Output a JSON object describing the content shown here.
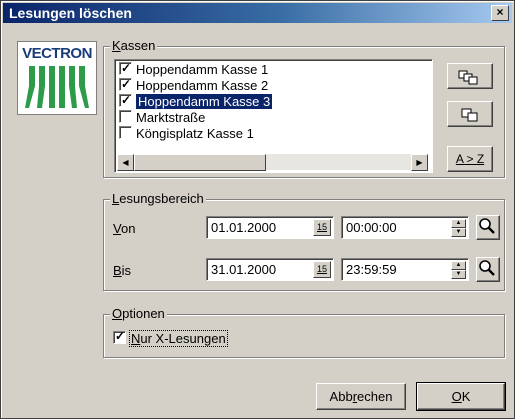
{
  "window": {
    "title": "Lesungen löschen",
    "close_glyph": "×"
  },
  "logo": {
    "text": "VECTRON"
  },
  "kassen": {
    "legend_key": "K",
    "legend_rest": "assen",
    "items": [
      {
        "label": "Hoppendamm Kasse 1",
        "checked": true,
        "selected": false
      },
      {
        "label": "Hoppendamm Kasse 2",
        "checked": true,
        "selected": false
      },
      {
        "label": "Hoppendamm Kasse 3",
        "checked": true,
        "selected": true
      },
      {
        "label": "Marktstraße",
        "checked": false,
        "selected": false
      },
      {
        "label": "Köngisplatz Kasse 1",
        "checked": false,
        "selected": false
      }
    ],
    "check_glyph": "✓",
    "scroll_left": "◀",
    "scroll_right": "▶"
  },
  "side_buttons": {
    "select_all_icon": "select-all-icon",
    "select_single_icon": "select-single-icon",
    "sort_label": "A > Z"
  },
  "range": {
    "legend_key": "L",
    "legend_rest": "esungsbereich",
    "from_key": "V",
    "from_rest": "on",
    "to_key": "B",
    "to_rest": "is",
    "from_date": "01.01.2000",
    "from_time": "00:00:00",
    "to_date": "31.01.2000",
    "to_time": "23:59:59",
    "cal_label": "15"
  },
  "options": {
    "legend_key": "O",
    "legend_rest": "ptionen",
    "only_x_key": "N",
    "only_x_rest": "ur X-Lesungen",
    "only_x_checked": true
  },
  "footer": {
    "cancel_pre": "Abb",
    "cancel_key": "r",
    "cancel_post": "echen",
    "ok_key": "O",
    "ok_rest": "K"
  },
  "colors": {
    "title_from": "#0a246a",
    "title_to": "#a6caf0",
    "selection": "#0a246a",
    "face": "#d4d0c8",
    "logo_blue": "#1a3d7a",
    "logo_green": "#2e9b4a"
  }
}
